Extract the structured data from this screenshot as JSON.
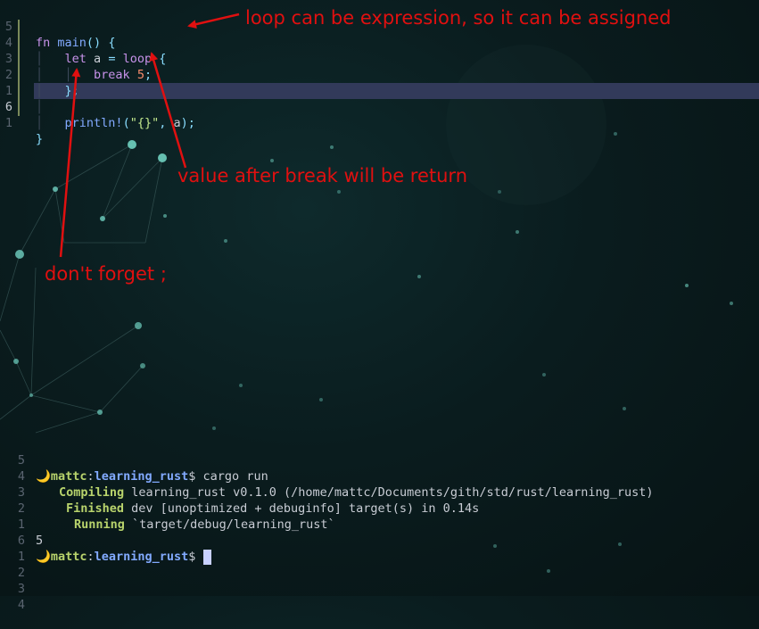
{
  "editor": {
    "lines": [
      {
        "num": "5",
        "text": "fn main() {"
      },
      {
        "num": "4",
        "text": "let a = loop {"
      },
      {
        "num": "3",
        "text": "break 5;"
      },
      {
        "num": "2",
        "text": "};"
      },
      {
        "num": "1",
        "text": ""
      },
      {
        "num": "6",
        "text": "println!(\"{}\", a);"
      },
      {
        "num": "1",
        "text": "}"
      }
    ]
  },
  "annotations": {
    "loop_expr": "loop can be expression, so it can be assigned",
    "break_value": "value after break will be return",
    "semicolon": "don't forget ;"
  },
  "terminal": {
    "prompt_icon": "🌙",
    "user": "mattc",
    "sep": ":",
    "dir": "learning_rust",
    "dollar": "$",
    "command": "cargo run",
    "compiling_label": "Compiling",
    "compiling_text": "learning_rust v0.1.0 (/home/mattc/Documents/gith/std/rust/learning_rust)",
    "finished_label": "Finished",
    "finished_text": "dev [unoptimized + debuginfo] target(s) in 0.14s",
    "running_label": "Running",
    "running_text": "`target/debug/learning_rust`",
    "output": "5",
    "line_numbers": [
      "5",
      "4",
      "3",
      "2",
      "1",
      "",
      "6",
      "1",
      "2",
      "3",
      "4"
    ]
  },
  "colors": {
    "annotation": "#e01010",
    "highlight": "#323a5a"
  }
}
